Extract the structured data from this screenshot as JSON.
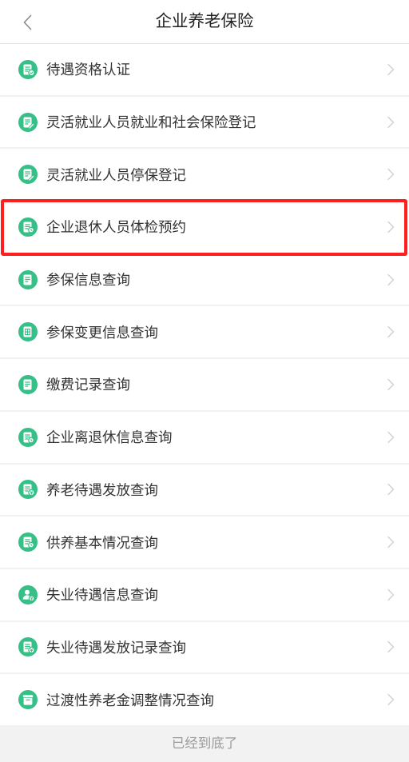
{
  "header": {
    "title": "企业养老保险",
    "back_icon": "chevron-left-icon"
  },
  "menu": {
    "chevron_icon": "chevron-right-icon",
    "items": [
      {
        "label": "待遇资格认证",
        "icon": "document-check-icon"
      },
      {
        "label": "灵活就业人员就业和社会保险登记",
        "icon": "document-edit-icon"
      },
      {
        "label": "灵活就业人员停保登记",
        "icon": "document-edit-icon"
      },
      {
        "label": "企业退休人员体检预约",
        "icon": "document-search-icon",
        "highlighted": true
      },
      {
        "label": "参保信息查询",
        "icon": "document-list-icon"
      },
      {
        "label": "参保变更信息查询",
        "icon": "document-grid-icon"
      },
      {
        "label": "缴费记录查询",
        "icon": "document-list-icon"
      },
      {
        "label": "企业离退休信息查询",
        "icon": "document-search-icon"
      },
      {
        "label": "养老待遇发放查询",
        "icon": "document-coin-icon"
      },
      {
        "label": "供养基本情况查询",
        "icon": "document-search-icon"
      },
      {
        "label": "失业待遇信息查询",
        "icon": "user-coin-icon"
      },
      {
        "label": "失业待遇发放记录查询",
        "icon": "document-coin-icon"
      },
      {
        "label": "过渡性养老金调整情况查询",
        "icon": "box-icon"
      }
    ]
  },
  "footer": {
    "text": "已经到底了"
  },
  "colors": {
    "icon_green": "#36bf86",
    "highlight_red": "#ff1f1f",
    "chevron_gray": "#cfcfcf",
    "back_gray": "#8a8a8a"
  }
}
